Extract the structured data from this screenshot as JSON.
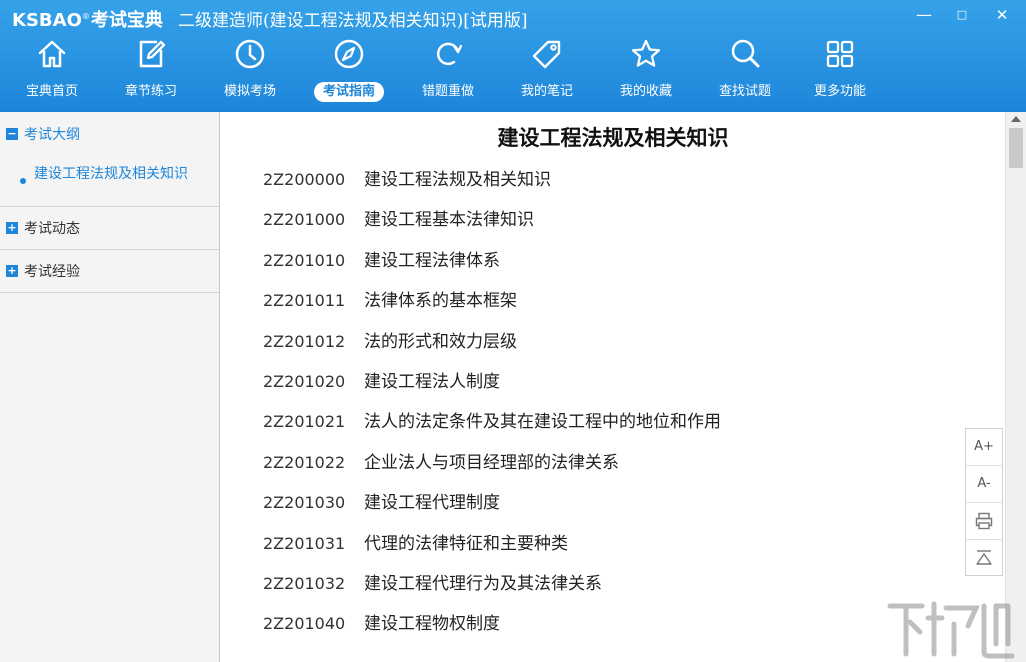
{
  "app": {
    "logo_en": "KSBAO",
    "logo_reg": "®",
    "logo_cn": "考试宝典",
    "window_title": "二级建造师(建设工程法规及相关知识)[试用版]"
  },
  "window_controls": {
    "minimize": "—",
    "maximize": "□",
    "close": "✕"
  },
  "toolbar": {
    "items": [
      {
        "label": "宝典首页",
        "icon": "home-icon"
      },
      {
        "label": "章节练习",
        "icon": "edit-icon"
      },
      {
        "label": "模拟考场",
        "icon": "clock-icon"
      },
      {
        "label": "考试指南",
        "icon": "compass-icon",
        "active": true
      },
      {
        "label": "错题重做",
        "icon": "refresh-icon"
      },
      {
        "label": "我的笔记",
        "icon": "tag-icon"
      },
      {
        "label": "我的收藏",
        "icon": "star-icon"
      },
      {
        "label": "查找试题",
        "icon": "search-icon"
      },
      {
        "label": "更多功能",
        "icon": "grid-icon"
      }
    ],
    "accent": "#1e86da"
  },
  "sidebar": {
    "sections": [
      {
        "label": "考试大纲",
        "toggle": "−",
        "expanded": true,
        "children": [
          "建设工程法规及相关知识"
        ]
      },
      {
        "label": "考试动态",
        "toggle": "+",
        "expanded": false
      },
      {
        "label": "考试经验",
        "toggle": "+",
        "expanded": false
      }
    ]
  },
  "content": {
    "title": "建设工程法规及相关知识",
    "outline": [
      {
        "code": "2Z200000",
        "title": "建设工程法规及相关知识"
      },
      {
        "code": "2Z201000",
        "title": "建设工程基本法律知识"
      },
      {
        "code": "2Z201010",
        "title": "建设工程法律体系"
      },
      {
        "code": "2Z201011",
        "title": "法律体系的基本框架"
      },
      {
        "code": "2Z201012",
        "title": "法的形式和效力层级"
      },
      {
        "code": "2Z201020",
        "title": "建设工程法人制度"
      },
      {
        "code": "2Z201021",
        "title": "法人的法定条件及其在建设工程中的地位和作用"
      },
      {
        "code": "2Z201022",
        "title": "企业法人与项目经理部的法律关系"
      },
      {
        "code": "2Z201030",
        "title": "建设工程代理制度"
      },
      {
        "code": "2Z201031",
        "title": "代理的法律特征和主要种类"
      },
      {
        "code": "2Z201032",
        "title": "建设工程代理行为及其法律关系"
      },
      {
        "code": "2Z201040",
        "title": "建设工程物权制度"
      }
    ]
  },
  "float_tools": {
    "font_increase": "A+",
    "font_decrease": "A-"
  },
  "watermark": {
    "text": "下载吧"
  }
}
